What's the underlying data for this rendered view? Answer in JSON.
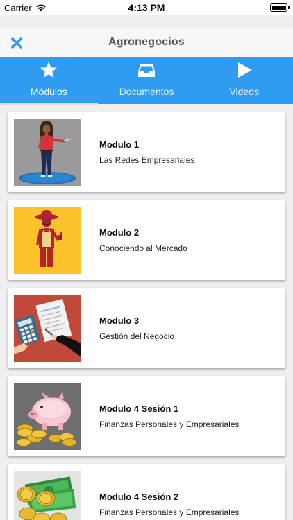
{
  "status_bar": {
    "carrier": "Carrier",
    "time": "4:13 PM",
    "wifi_icon": "wifi-icon",
    "battery_icon": "battery-icon"
  },
  "header": {
    "title": "Agronegocios",
    "close_icon": "close-icon"
  },
  "tabs": [
    {
      "label": "Módulos",
      "icon": "star-icon",
      "active": true
    },
    {
      "label": "Documentos",
      "icon": "inbox-icon",
      "active": false
    },
    {
      "label": "Videos",
      "icon": "play-icon",
      "active": false
    }
  ],
  "modules": [
    {
      "title": "Modulo 1",
      "subtitle": "Las Redes Empresariales",
      "image": "presenter-woman-image"
    },
    {
      "title": "Modulo 2",
      "subtitle": "Conociendo al Mercado",
      "image": "farmer-image"
    },
    {
      "title": "Modulo 3",
      "subtitle": "Gestión del Negocio",
      "image": "calculator-document-image"
    },
    {
      "title": "Modulo 4 Sesión 1",
      "subtitle": "Finanzas Personales y Empresariales",
      "image": "piggy-bank-coins-image"
    },
    {
      "title": "Modulo 4 Sesión 2",
      "subtitle": "Finanzas Personales y Empresariales",
      "image": "money-coins-image"
    }
  ],
  "colors": {
    "accent": "#2f9cf2",
    "close_icon": "#2f9cf2",
    "tab_indicator": "#f0d9b5",
    "background": "#efefef"
  }
}
